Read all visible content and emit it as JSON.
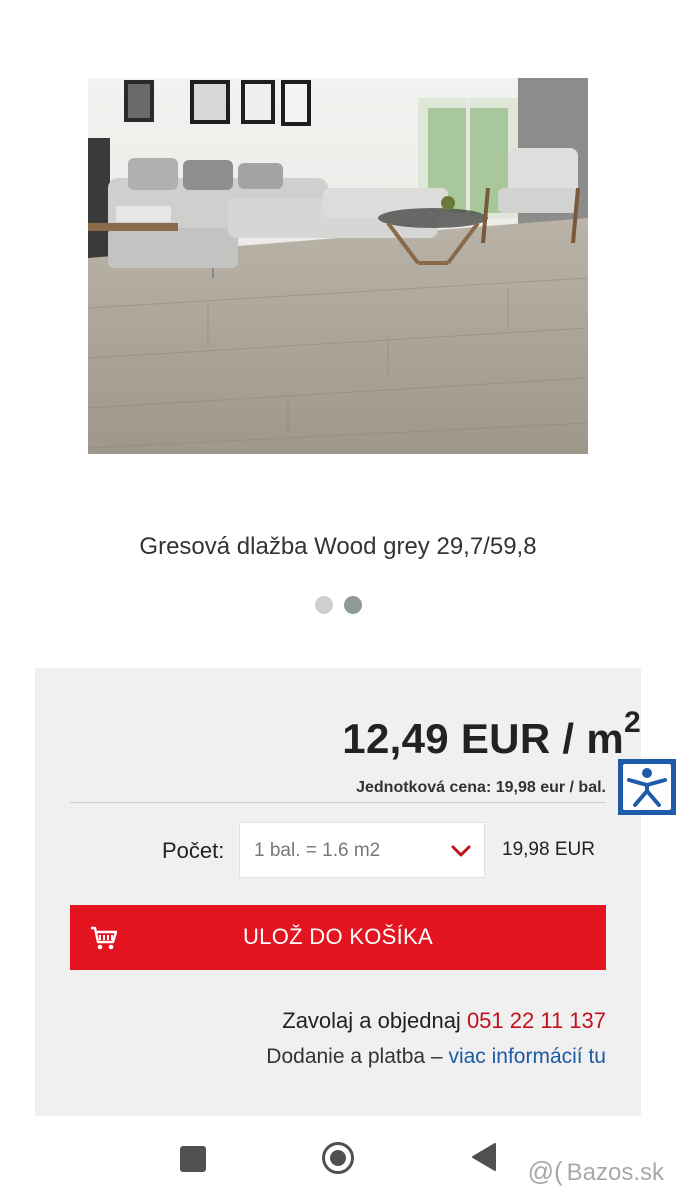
{
  "product": {
    "title": "Gresová dlažba Wood grey 29,7/59,8",
    "image_icon": "product-photo-living-room",
    "carousel_count": 2,
    "carousel_active_index": 1
  },
  "pricing": {
    "price_main": "12,49 EUR / m",
    "price_unit_sup": "2",
    "unit_price_text": "Jednotková cena: 19,98 eur / bal."
  },
  "quantity": {
    "label": "Počet:",
    "selected": "1 bal. = 1.6 m2",
    "total": "19,98 EUR"
  },
  "cart": {
    "button_label": "ULOŽ DO KOŠÍKA",
    "icon": "cart-icon"
  },
  "contact": {
    "call_text": "Zavolaj a objednaj ",
    "phone": "051 22 11 137",
    "delivery_text": "Dodanie a platba – ",
    "delivery_link": "viac informácií tu"
  },
  "watermark": {
    "text": "Bazos.sk"
  },
  "colors": {
    "accent_red": "#e3131f",
    "phone_red": "#c3101b",
    "link_blue": "#1d5aa6",
    "accessibility_blue": "#1f5ba8"
  }
}
